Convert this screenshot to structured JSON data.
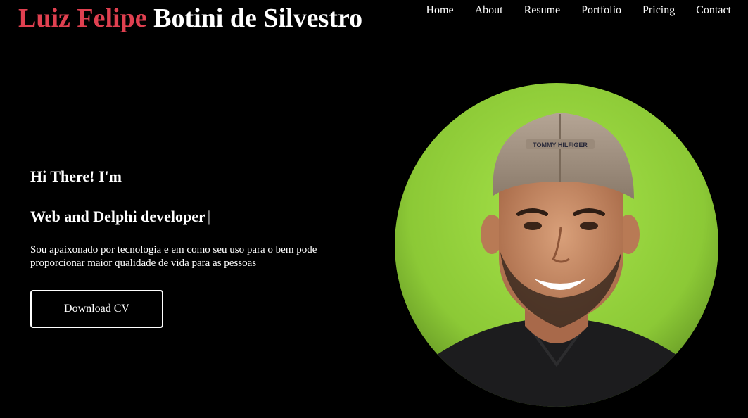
{
  "header": {
    "name_first": "Luiz Felipe",
    "name_last": "Botini de Silvestro"
  },
  "nav": {
    "items": [
      {
        "label": "Home"
      },
      {
        "label": "About"
      },
      {
        "label": "Resume"
      },
      {
        "label": "Portfolio"
      },
      {
        "label": "Pricing"
      },
      {
        "label": "Contact"
      }
    ]
  },
  "hero": {
    "greeting": "Hi There! I'm",
    "role": "Web and Delphi developer",
    "caret": "|",
    "intro": "Sou apaixonado por tecnologia e em como seu uso para o bem pode proporcionar maior qualidade de vida para as pessoas",
    "download_label": "Download CV",
    "cap_brand": "TOMMY HILFIGER"
  },
  "colors": {
    "background": "#000000",
    "accent": "#e04050",
    "text": "#ffffff",
    "portrait_background": "#8fd13a"
  }
}
